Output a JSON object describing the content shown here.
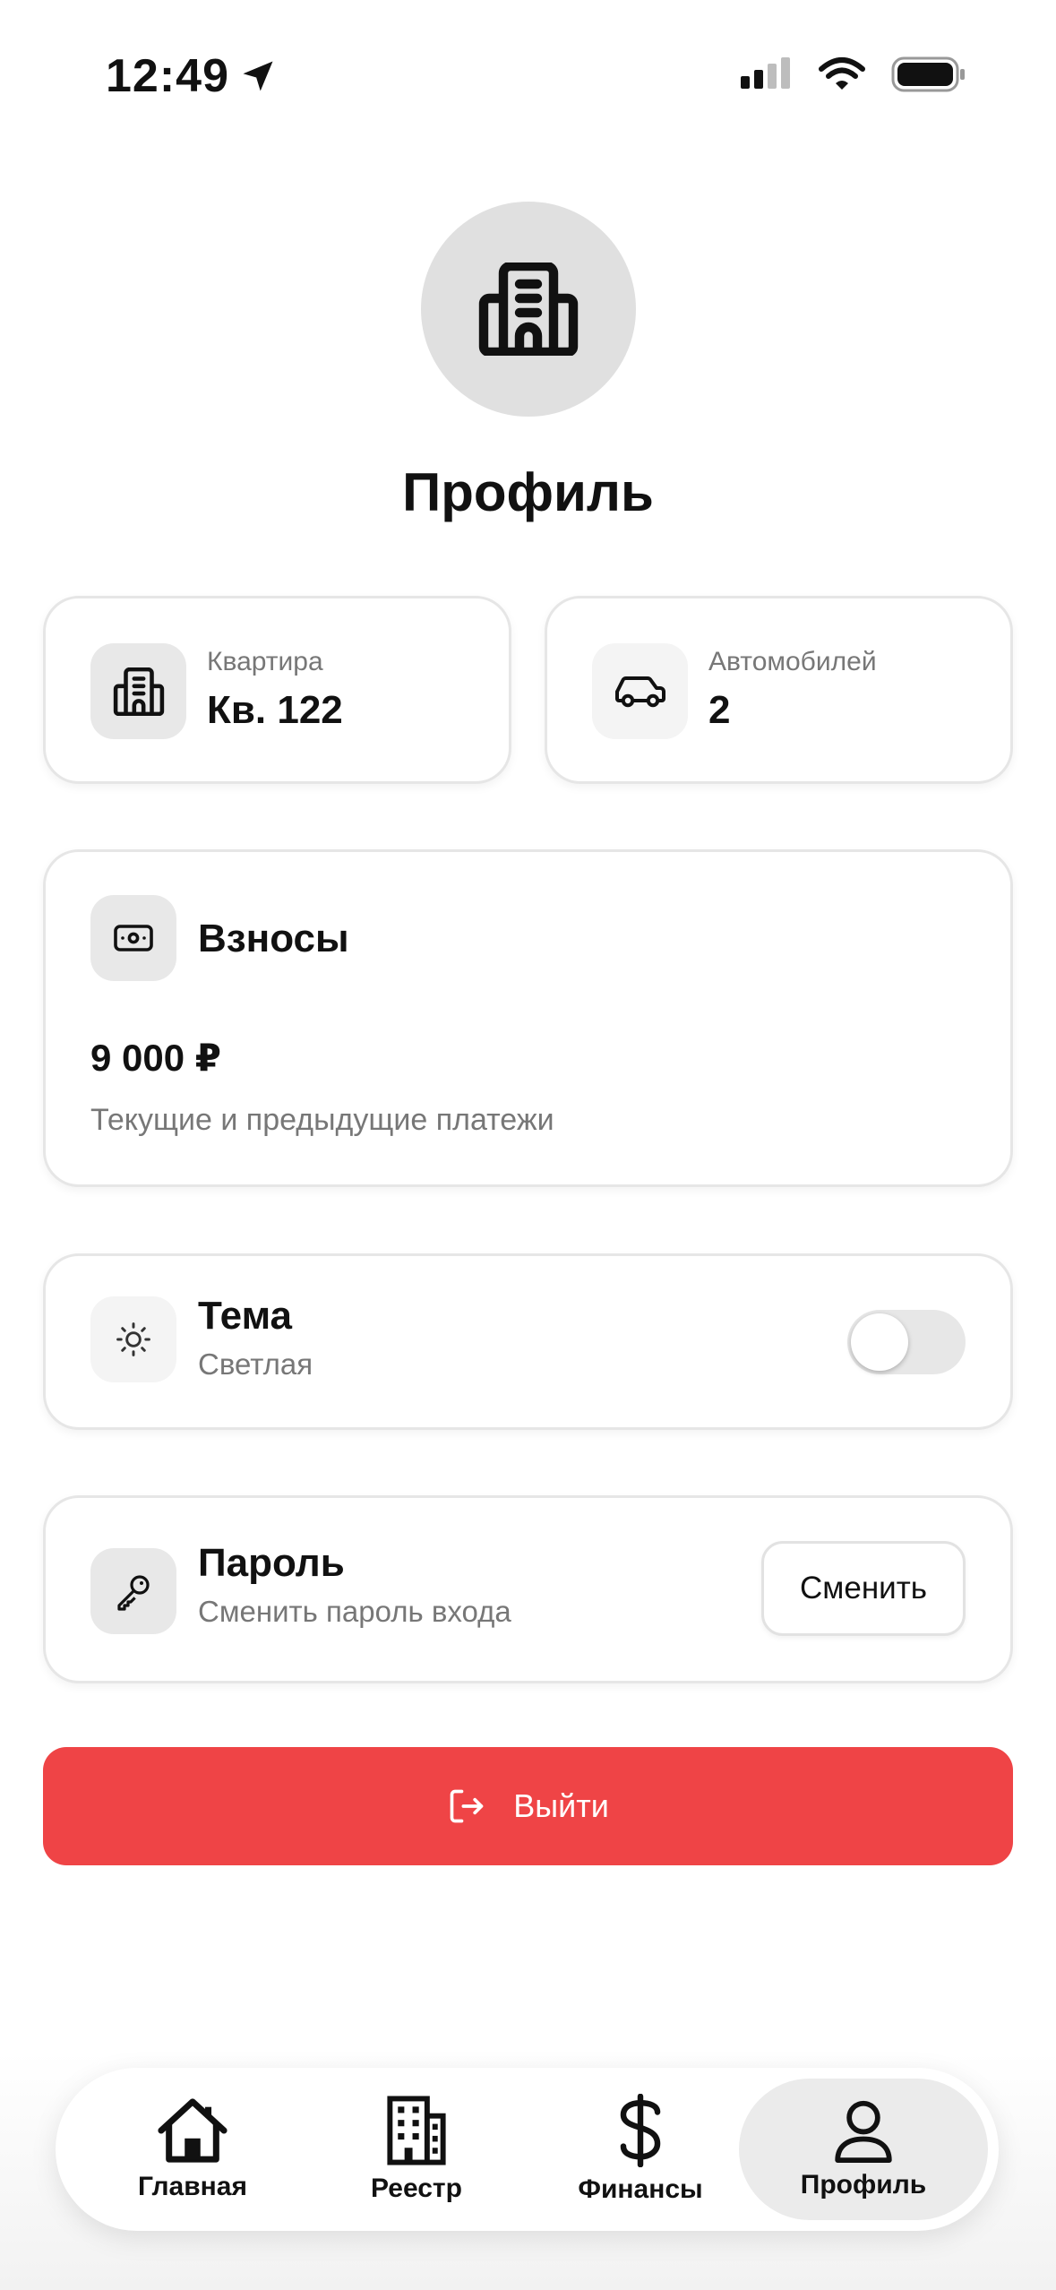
{
  "status_bar": {
    "time": "12:49",
    "icons": [
      "location-arrow-icon",
      "cellular-signal-icon",
      "wifi-icon",
      "battery-icon"
    ]
  },
  "profile": {
    "title": "Профиль",
    "avatar_icon": "building-icon"
  },
  "stats": {
    "apartment": {
      "label": "Квартира",
      "value": "Кв. 122",
      "icon": "building-icon"
    },
    "cars": {
      "label": "Автомобилей",
      "value": "2",
      "icon": "car-icon"
    }
  },
  "fees": {
    "title": "Взносы",
    "amount": "9 000 ₽",
    "subtitle": "Текущие и предыдущие платежи",
    "icon": "banknote-icon"
  },
  "theme": {
    "title": "Тема",
    "value": "Светлая",
    "toggle_on": false,
    "icon": "sun-icon"
  },
  "password": {
    "title": "Пароль",
    "subtitle": "Сменить пароль входа",
    "button_label": "Сменить",
    "icon": "key-icon"
  },
  "logout": {
    "label": "Выйти",
    "icon": "logout-icon",
    "color": "#ef4446"
  },
  "tabbar": {
    "items": [
      {
        "label": "Главная",
        "icon": "home-icon",
        "active": false
      },
      {
        "label": "Реестр",
        "icon": "building-icon",
        "active": false
      },
      {
        "label": "Финансы",
        "icon": "dollar-icon",
        "active": false
      },
      {
        "label": "Профиль",
        "icon": "user-icon",
        "active": true
      }
    ]
  }
}
